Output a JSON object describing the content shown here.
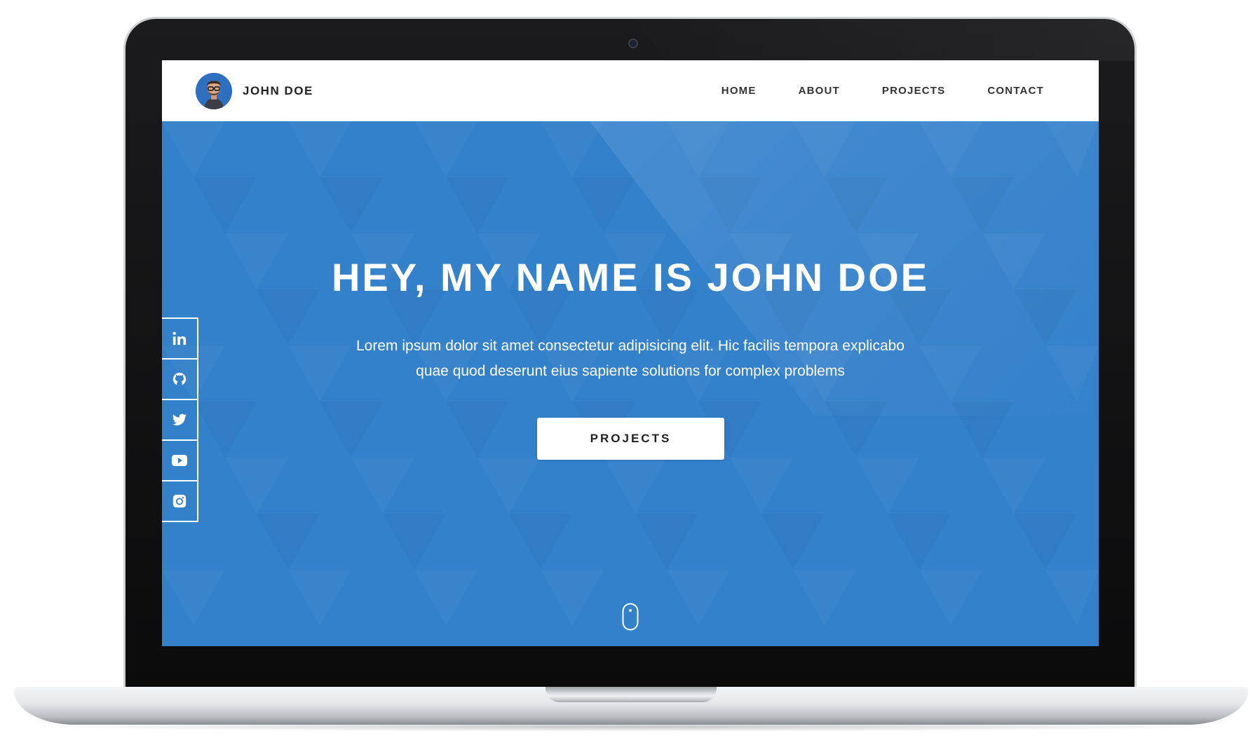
{
  "navbar": {
    "brand_name": "JOHN DOE",
    "links": [
      "HOME",
      "ABOUT",
      "PROJECTS",
      "CONTACT"
    ]
  },
  "hero": {
    "title": "HEY, MY NAME IS JOHN DOE",
    "text": "Lorem ipsum dolor sit amet consectetur adipisicing elit. Hic facilis tempora explicabo quae quod deserunt eius sapiente solutions for complex problems",
    "button_label": "PROJECTS"
  },
  "social": [
    "linkedin-icon",
    "github-icon",
    "twitter-icon",
    "youtube-icon",
    "instagram-icon"
  ],
  "colors": {
    "hero_blue": "#3380cb",
    "nav_bg": "#ffffff",
    "text_dark": "#222222",
    "avatar_blue": "#2f6fbf"
  }
}
